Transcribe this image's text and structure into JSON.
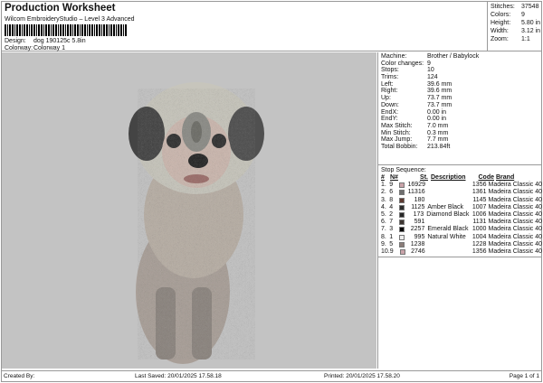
{
  "header": {
    "title": "Production Worksheet",
    "subtitle": "Wilcom EmbroideryStudio – Level 3 Advanced",
    "design_label": "Design:",
    "design": "dog 190125c 5.8in",
    "colorway_label": "Colorway:",
    "colorway": "Colorway 1"
  },
  "stats": [
    {
      "k": "Stitches:",
      "v": "37548"
    },
    {
      "k": "Colors:",
      "v": "9"
    },
    {
      "k": "Height:",
      "v": "5.80 in"
    },
    {
      "k": "Width:",
      "v": "3.12 in"
    },
    {
      "k": "Zoom:",
      "v": "1:1"
    }
  ],
  "info": [
    {
      "k": "Machine:",
      "v": "Brother / Babylock"
    },
    {
      "k": "Color changes:",
      "v": "9"
    },
    {
      "k": "Stops:",
      "v": "10"
    },
    {
      "k": "Trims:",
      "v": "124"
    },
    {
      "k": "Left:",
      "v": "39.6 mm"
    },
    {
      "k": "Right:",
      "v": "39.6 mm"
    },
    {
      "k": "Up:",
      "v": "73.7 mm"
    },
    {
      "k": "Down:",
      "v": "73.7 mm"
    },
    {
      "k": "EndX:",
      "v": "0.00 in"
    },
    {
      "k": "EndY:",
      "v": "0.00 in"
    },
    {
      "k": "Max Stitch:",
      "v": "7.0 mm"
    },
    {
      "k": "Min Stitch:",
      "v": "0.3 mm"
    },
    {
      "k": "Max Jump:",
      "v": "7.7 mm"
    },
    {
      "k": "Total Bobbin:",
      "v": "213.84ft"
    }
  ],
  "sequence": {
    "title": "Stop Sequence:",
    "headers": [
      "#",
      "N#",
      "St.",
      "Description",
      "Code",
      "Brand"
    ],
    "rows": [
      {
        "i": "1.",
        "n": "9",
        "color": "#c9a3a9",
        "st": "16929",
        "d": "",
        "code": "1356",
        "brand": "Madeira Classic 40"
      },
      {
        "i": "2.",
        "n": "6",
        "color": "#6e6e6e",
        "st": "11316",
        "d": "",
        "code": "1361",
        "brand": "Madeira Classic 40"
      },
      {
        "i": "3.",
        "n": "8",
        "color": "#5e3a32",
        "st": "180",
        "d": "",
        "code": "1145",
        "brand": "Madeira Classic 40"
      },
      {
        "i": "4.",
        "n": "4",
        "color": "#2c2c2c",
        "st": "1125",
        "d": "Amber Black",
        "code": "1007",
        "brand": "Madeira Classic 40"
      },
      {
        "i": "5.",
        "n": "2",
        "color": "#262626",
        "st": "173",
        "d": "Diamond Black",
        "code": "1006",
        "brand": "Madeira Classic 40"
      },
      {
        "i": "6.",
        "n": "7",
        "color": "#3e3632",
        "st": "591",
        "d": "",
        "code": "1131",
        "brand": "Madeira Classic 40"
      },
      {
        "i": "7.",
        "n": "3",
        "color": "#080808",
        "st": "2257",
        "d": "Emerald Black",
        "code": "1000",
        "brand": "Madeira Classic 40"
      },
      {
        "i": "8.",
        "n": "1",
        "color": "#eeeeee",
        "st": "995",
        "d": "Natural White",
        "code": "1004",
        "brand": "Madeira Classic 40"
      },
      {
        "i": "9.",
        "n": "5",
        "color": "#8a7c78",
        "st": "1238",
        "d": "",
        "code": "1228",
        "brand": "Madeira Classic 40"
      },
      {
        "i": "10.",
        "n": "9",
        "color": "#c9a3a9",
        "st": "2746",
        "d": "",
        "code": "1356",
        "brand": "Madeira Classic 40"
      }
    ]
  },
  "footer": {
    "created": "Created By:",
    "saved": "Last Saved: 20/01/2025 17.58.18",
    "printed": "Printed: 20/01/2025 17.58.20",
    "page": "Page 1 of 1"
  }
}
